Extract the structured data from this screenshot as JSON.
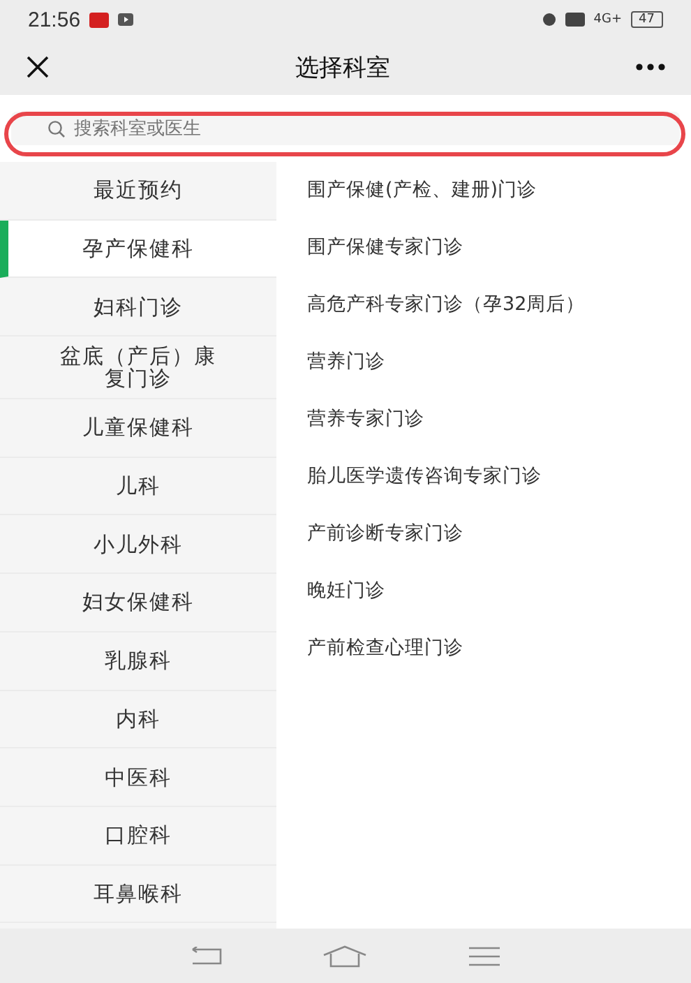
{
  "status_bar": {
    "time": "21:56",
    "network": "4G+",
    "battery": "47"
  },
  "nav": {
    "title": "选择科室"
  },
  "search": {
    "placeholder": "搜索科室或医生"
  },
  "departments": [
    {
      "label": "最近预约",
      "selected": false
    },
    {
      "label": "孕产保健科",
      "selected": true
    },
    {
      "label": "妇科门诊",
      "selected": false
    },
    {
      "label": "盆底（产后）康复门诊",
      "selected": false
    },
    {
      "label": "儿童保健科",
      "selected": false
    },
    {
      "label": "儿科",
      "selected": false
    },
    {
      "label": "小儿外科",
      "selected": false
    },
    {
      "label": "妇女保健科",
      "selected": false
    },
    {
      "label": "乳腺科",
      "selected": false
    },
    {
      "label": "内科",
      "selected": false
    },
    {
      "label": "中医科",
      "selected": false
    },
    {
      "label": "口腔科",
      "selected": false
    },
    {
      "label": "耳鼻喉科",
      "selected": false
    }
  ],
  "clinics": [
    "围产保健(产检、建册)门诊",
    "围产保健专家门诊",
    "高危产科专家门诊（孕32周后）",
    "营养门诊",
    "营养专家门诊",
    "胎儿医学遗传咨询专家门诊",
    "产前诊断专家门诊",
    "晚妊门诊",
    "产前检查心理门诊"
  ]
}
